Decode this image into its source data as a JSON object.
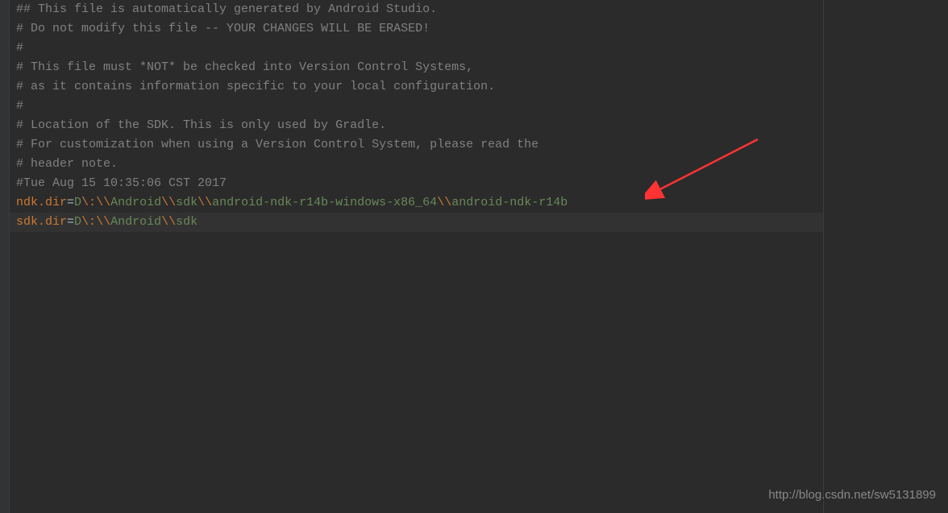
{
  "code": {
    "line1": "## This file is automatically generated by Android Studio.",
    "line2": "# Do not modify this file -- YOUR CHANGES WILL BE ERASED!",
    "line3": "#",
    "line4": "# This file must *NOT* be checked into Version Control Systems,",
    "line5": "# as it contains information specific to your local configuration.",
    "line6": "#",
    "line7": "# Location of the SDK. This is only used by Gradle.",
    "line8": "# For customization when using a Version Control System, please read the",
    "line9": "# header note.",
    "line10": "#Tue Aug 15 10:35:06 CST 2017",
    "ndk": {
      "key": "ndk.dir",
      "eq": "=",
      "drive": "D",
      "esc1": "\\:",
      "esc2": "\\\\",
      "seg1": "Android",
      "esc3": "\\\\",
      "seg2": "sdk",
      "esc4": "\\\\",
      "seg3": "android-ndk-r14b-windows-x86_64",
      "esc5": "\\\\",
      "seg4": "android-ndk-r14b"
    },
    "sdk": {
      "key": "sdk.dir",
      "eq": "=",
      "drive": "D",
      "esc1": "\\:",
      "esc2": "\\\\",
      "seg1": "Android",
      "esc3": "\\\\",
      "seg2": "sdk"
    }
  },
  "watermark": "http://blog.csdn.net/sw5131899"
}
